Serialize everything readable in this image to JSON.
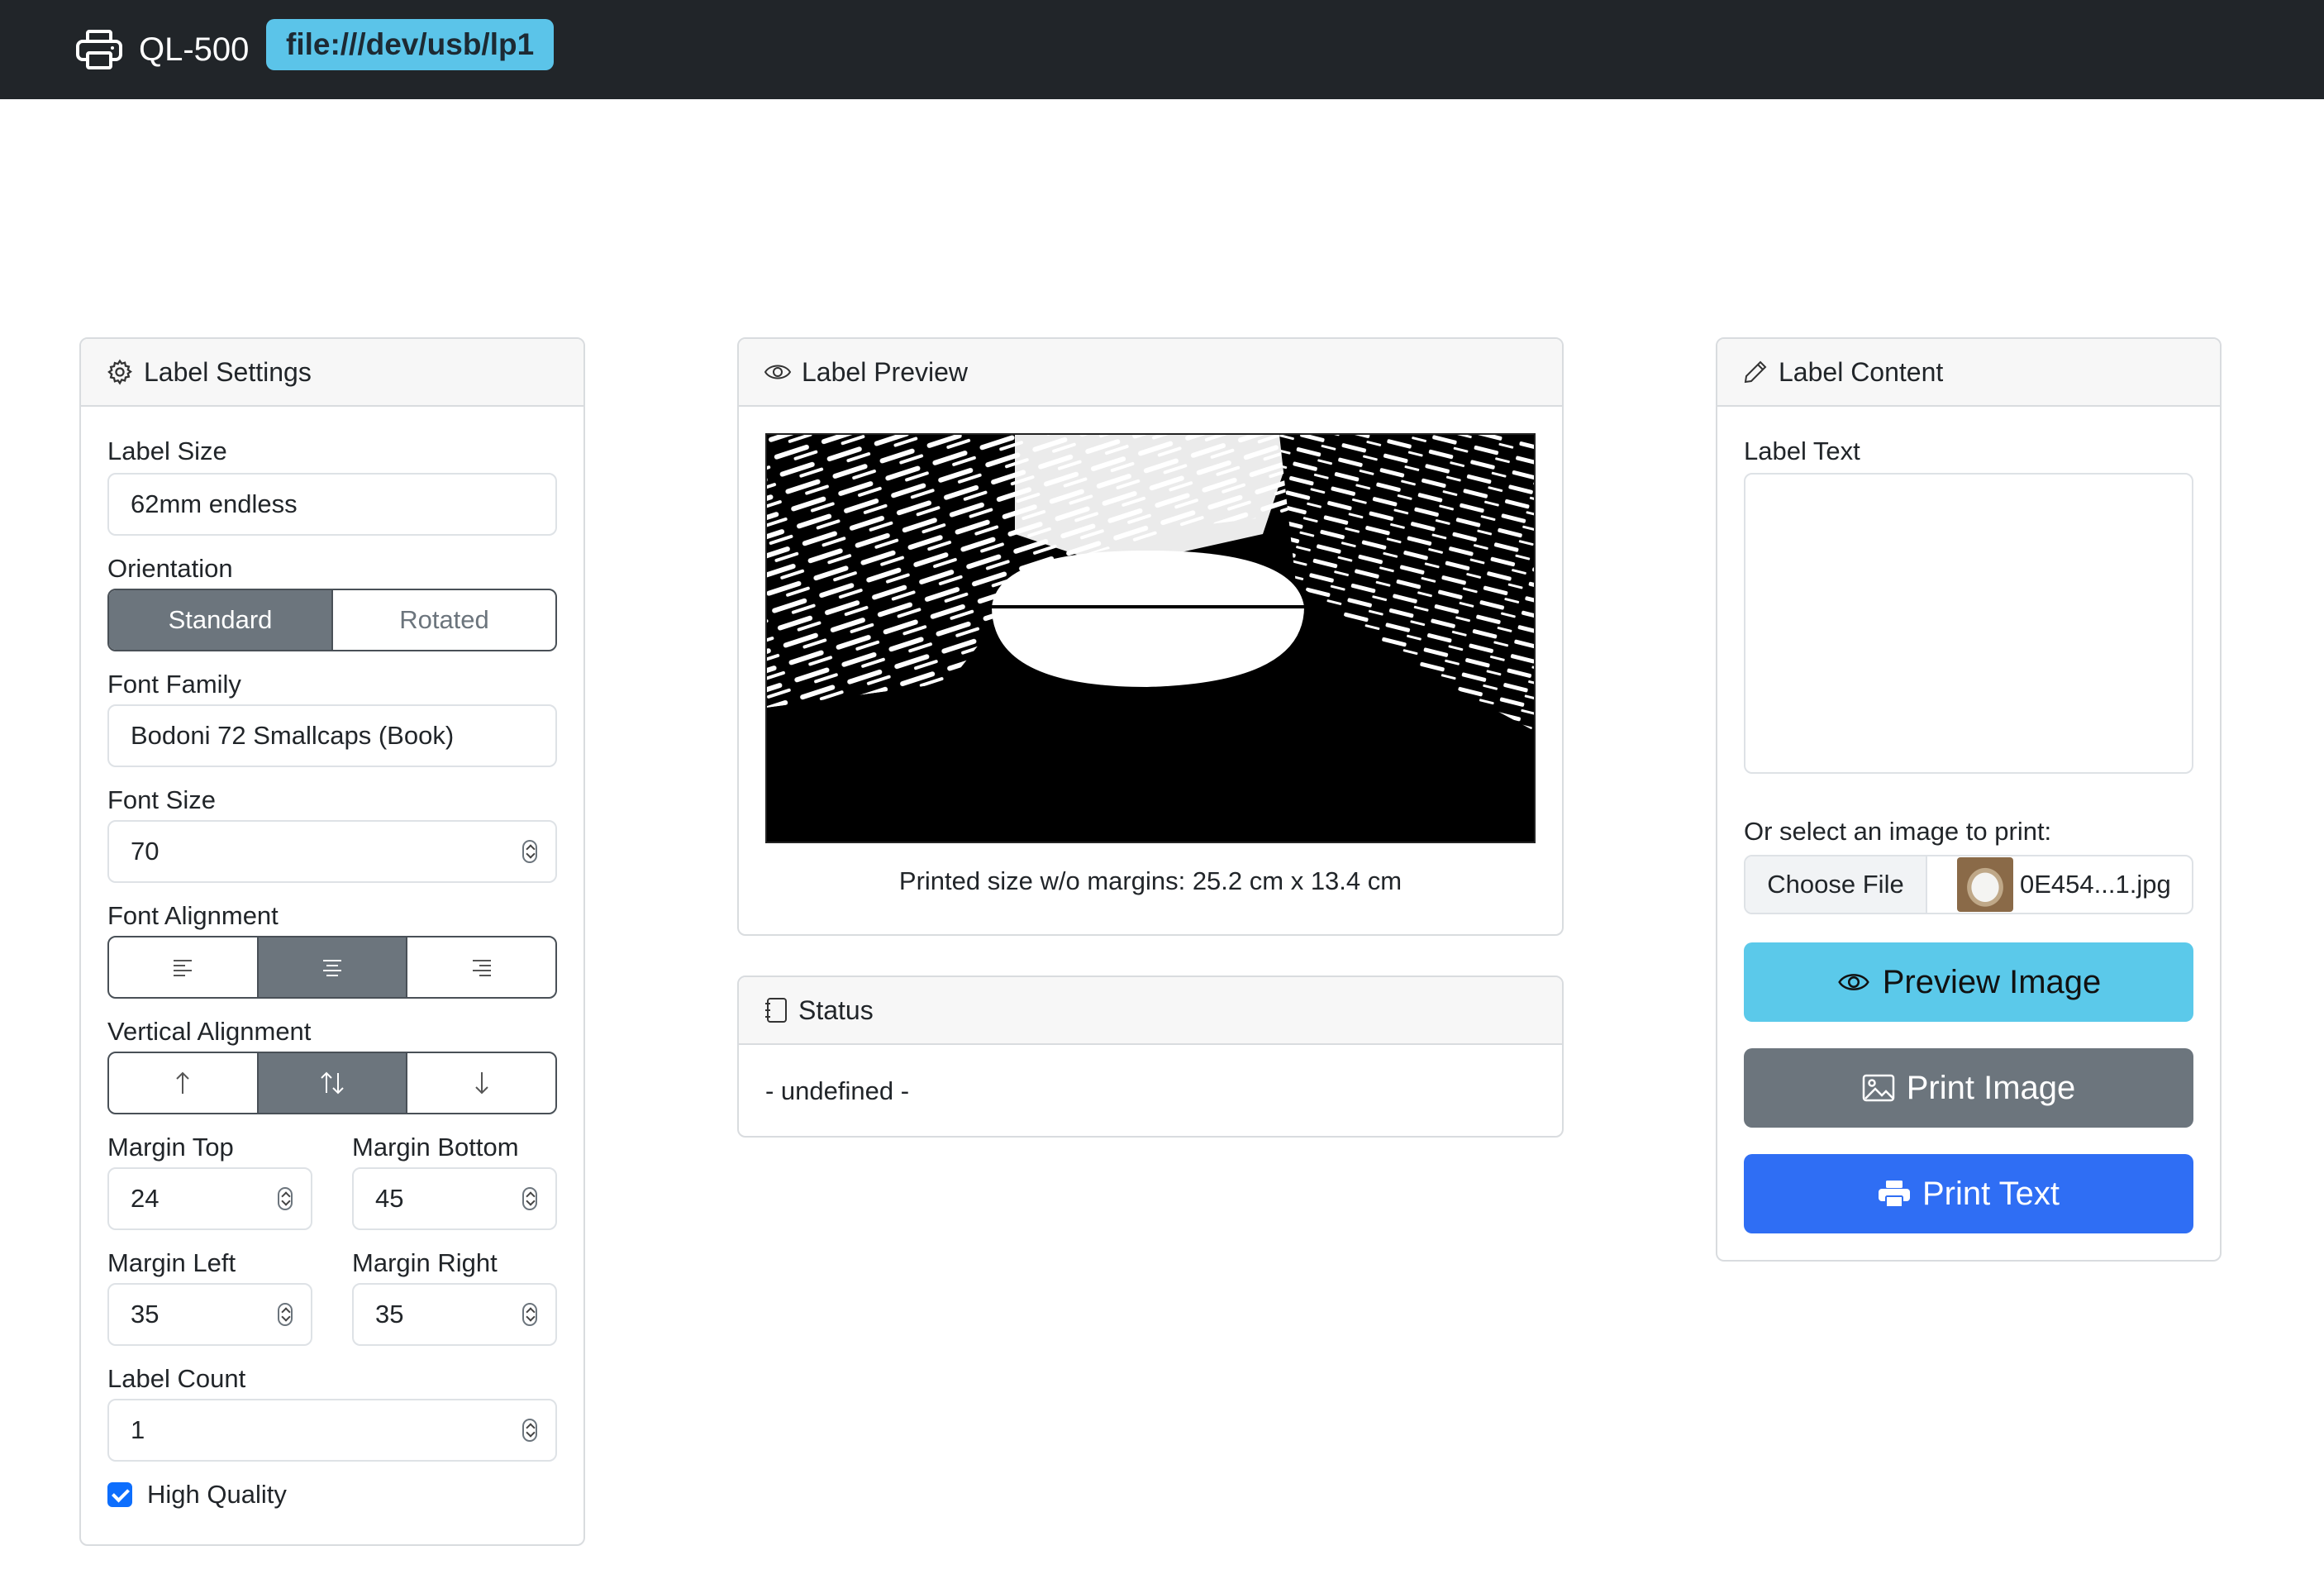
{
  "navbar": {
    "printer_icon": "printer-icon",
    "title": "QL-500",
    "device": "file:///dev/usb/lp1"
  },
  "settings": {
    "title": "Label Settings",
    "icon": "gear-icon",
    "label_size_label": "Label Size",
    "label_size_value": "62mm endless",
    "orientation_label": "Orientation",
    "orientation_options": [
      "Standard",
      "Rotated"
    ],
    "orientation_selected": "Standard",
    "font_family_label": "Font Family",
    "font_family_value": "Bodoni 72 Smallcaps (Book)",
    "font_size_label": "Font Size",
    "font_size_value": "70",
    "font_alignment_label": "Font Alignment",
    "font_alignment_selected": "center",
    "vertical_alignment_label": "Vertical Alignment",
    "vertical_alignment_selected": "middle",
    "margin_top_label": "Margin Top",
    "margin_top_value": "24",
    "margin_bottom_label": "Margin Bottom",
    "margin_bottom_value": "45",
    "margin_left_label": "Margin Left",
    "margin_left_value": "35",
    "margin_right_label": "Margin Right",
    "margin_right_value": "35",
    "label_count_label": "Label Count",
    "label_count_value": "1",
    "high_quality_label": "High Quality",
    "high_quality_checked": true
  },
  "preview": {
    "title": "Label Preview",
    "icon": "eye-icon",
    "caption": "Printed size w/o margins: 25.2 cm x 13.4 cm"
  },
  "status": {
    "title": "Status",
    "icon": "notepad-icon",
    "text": "- undefined -"
  },
  "content": {
    "title": "Label Content",
    "icon": "pencil-icon",
    "label_text_label": "Label Text",
    "label_text_value": "",
    "image_select_label": "Or select an image to print:",
    "choose_file_label": "Choose File",
    "file_name": "0E454...1.jpg",
    "preview_button": "Preview Image",
    "print_image_button": "Print Image",
    "print_text_button": "Print Text"
  },
  "colors": {
    "navbar_bg": "#212529",
    "badge_bg": "#5bc4e9",
    "info": "#5bc9ea",
    "secondary": "#6c757d",
    "primary": "#2f6ef4"
  }
}
